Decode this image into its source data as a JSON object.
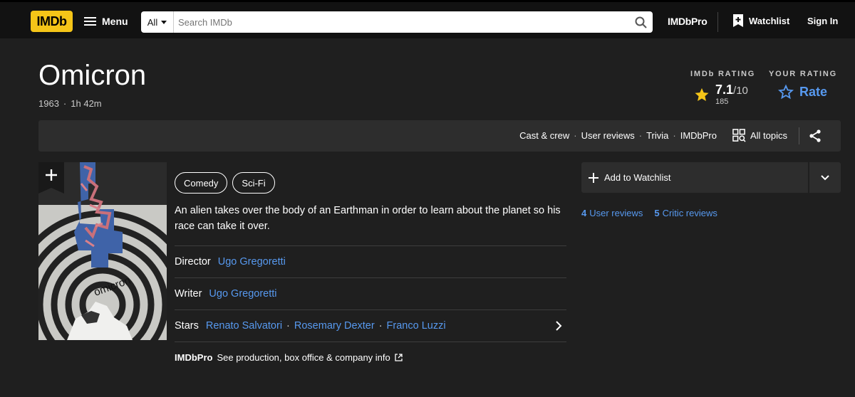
{
  "nav": {
    "logo": "IMDb",
    "menu_label": "Menu",
    "search_category": "All",
    "search_placeholder": "Search IMDb",
    "pro_label": "IMDbPro",
    "watchlist_label": "Watchlist",
    "signin_label": "Sign In"
  },
  "title": {
    "name": "Omicron",
    "year": "1963",
    "separator": "·",
    "runtime": "1h 42m"
  },
  "rating": {
    "imdb_heading": "IMDb RATING",
    "score": "7.1",
    "score_out_of": "/10",
    "votes": "185",
    "your_heading": "YOUR RATING",
    "rate_label": "Rate"
  },
  "subnav": {
    "links": [
      "Cast & crew",
      "User reviews",
      "Trivia",
      "IMDbPro"
    ],
    "all_topics": "All topics"
  },
  "genres": [
    "Comedy",
    "Sci-Fi"
  ],
  "plot": "An alien takes over the body of an Earthman in order to learn about the planet so his race can take it over.",
  "credits": {
    "director_label": "Director",
    "director": "Ugo Gregoretti",
    "writer_label": "Writer",
    "writer": "Ugo Gregoretti",
    "stars_label": "Stars",
    "stars": [
      "Renato Salvatori",
      "Rosemary Dexter",
      "Franco Luzzi"
    ]
  },
  "pro_bar": {
    "logo": "IMDbPro",
    "text": "See production, box office & company info"
  },
  "poster": {
    "title_text": "omicron"
  },
  "actions": {
    "watchlist_button": "Add to Watchlist",
    "user_reviews_count": "4",
    "user_reviews_label": "User reviews",
    "critic_reviews_count": "5",
    "critic_reviews_label": "Critic reviews"
  },
  "colors": {
    "accent": "#f5c518",
    "link": "#5799ef",
    "background": "#1f1f1f",
    "nav_bg": "#121212"
  }
}
